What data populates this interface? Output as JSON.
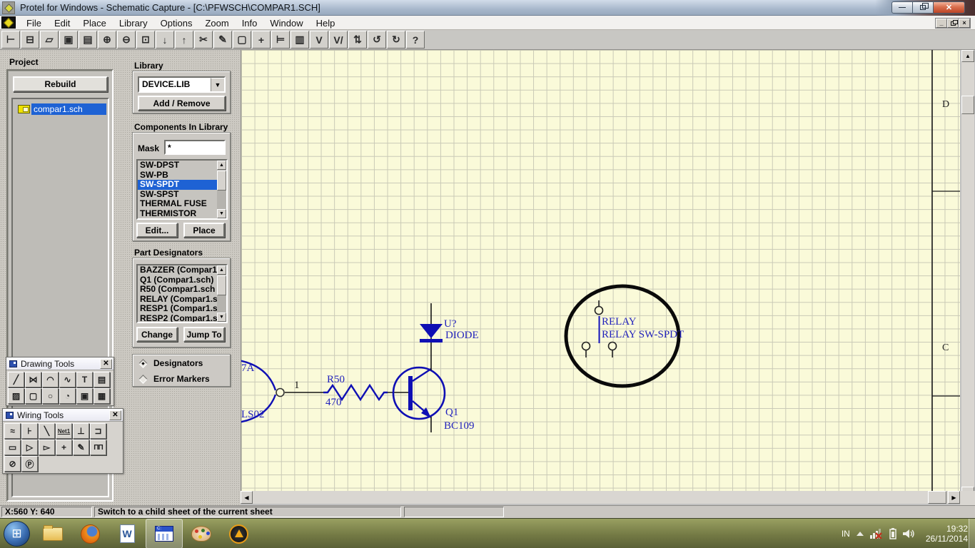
{
  "window": {
    "title": "Protel for Windows - Schematic Capture - [C:\\PFWSCH\\COMPAR1.SCH]"
  },
  "menu": {
    "items": [
      "File",
      "Edit",
      "Place",
      "Library",
      "Options",
      "Zoom",
      "Info",
      "Window",
      "Help"
    ]
  },
  "toolbar": {
    "buttons": [
      {
        "name": "project-hierarchy-button",
        "glyph": "⊢"
      },
      {
        "name": "sheet-symbols-button",
        "glyph": "⊟"
      },
      {
        "name": "open-button",
        "glyph": "▱"
      },
      {
        "name": "save-button",
        "glyph": "▣"
      },
      {
        "name": "print-button",
        "glyph": "▤"
      },
      {
        "name": "zoom-in-button",
        "glyph": "⊕"
      },
      {
        "name": "zoom-out-button",
        "glyph": "⊖"
      },
      {
        "name": "zoom-area-button",
        "glyph": "⊡"
      },
      {
        "name": "descend-sheet-button",
        "glyph": "↓"
      },
      {
        "name": "ascend-sheet-button",
        "glyph": "↑"
      },
      {
        "name": "cut-button",
        "glyph": "✂"
      },
      {
        "name": "draw-button",
        "glyph": "✎"
      },
      {
        "name": "select-area-button",
        "glyph": "▢"
      },
      {
        "name": "move-button",
        "glyph": "+"
      },
      {
        "name": "wire-mode-button",
        "glyph": "⊨"
      },
      {
        "name": "part-browser-button",
        "glyph": "▥"
      },
      {
        "name": "wiring-tools-toggle",
        "glyph": "V"
      },
      {
        "name": "drawing-tools-toggle",
        "glyph": "V/"
      },
      {
        "name": "annotate-button",
        "glyph": "⇅"
      },
      {
        "name": "undo-button",
        "glyph": "↺"
      },
      {
        "name": "redo-button",
        "glyph": "↻"
      },
      {
        "name": "help-button",
        "glyph": "?"
      }
    ]
  },
  "project": {
    "label": "Project",
    "rebuild_label": "Rebuild",
    "files": [
      {
        "name": "project-file-compar1",
        "label": "compar1.sch",
        "selected": true
      }
    ]
  },
  "library": {
    "label": "Library",
    "selected_library": "DEVICE.LIB",
    "add_remove_label": "Add / Remove"
  },
  "components": {
    "label": "Components In Library",
    "mask_label": "Mask",
    "mask_value": "*",
    "items": [
      {
        "label": "SW-DPST"
      },
      {
        "label": "SW-PB"
      },
      {
        "label": "SW-SPDT",
        "selected": true
      },
      {
        "label": "SW-SPST"
      },
      {
        "label": "THERMAL FUSE"
      },
      {
        "label": "THERMISTOR"
      }
    ],
    "edit_label": "Edit...",
    "place_label": "Place"
  },
  "part_designators": {
    "label": "Part Designators",
    "items": [
      {
        "label": "BAZZER (Compar1"
      },
      {
        "label": "Q1 (Compar1.sch)"
      },
      {
        "label": "R50 (Compar1.sch"
      },
      {
        "label": "RELAY (Compar1.s"
      },
      {
        "label": "RESP1 (Compar1.s"
      },
      {
        "label": "RESP2 (Compar1.s"
      }
    ],
    "change_label": "Change",
    "jump_to_label": "Jump To"
  },
  "display_options": {
    "options": [
      {
        "name": "option-designators",
        "label": "Designators",
        "selected": true
      },
      {
        "name": "option-error-markers",
        "label": "Error Markers",
        "selected": false
      }
    ]
  },
  "drawing_tools": {
    "title": "Drawing Tools",
    "tools": [
      {
        "name": "tool-line",
        "glyph": "╱"
      },
      {
        "name": "tool-polygon",
        "glyph": "⋈"
      },
      {
        "name": "tool-arc",
        "glyph": "◠"
      },
      {
        "name": "tool-bezier",
        "glyph": "∿"
      },
      {
        "name": "tool-text",
        "glyph": "T"
      },
      {
        "name": "tool-text-frame",
        "glyph": "▤"
      },
      {
        "name": "tool-rectangle",
        "glyph": "▨"
      },
      {
        "name": "tool-round-rect",
        "glyph": "▢"
      },
      {
        "name": "tool-ellipse",
        "glyph": "○"
      },
      {
        "name": "tool-pie",
        "glyph": "◔"
      },
      {
        "name": "tool-image",
        "glyph": "▣"
      },
      {
        "name": "tool-paste-array",
        "glyph": "▦"
      }
    ]
  },
  "wiring_tools": {
    "title": "Wiring Tools",
    "tools": [
      {
        "name": "tool-wire",
        "glyph": "≈"
      },
      {
        "name": "tool-bus",
        "glyph": "⊦"
      },
      {
        "name": "tool-bus-entry",
        "glyph": "╲"
      },
      {
        "name": "tool-net-label",
        "glyph": "Net1"
      },
      {
        "name": "tool-power-port",
        "glyph": "⊥"
      },
      {
        "name": "tool-part",
        "glyph": "⊐"
      },
      {
        "name": "tool-sheet-symbol",
        "glyph": "▭"
      },
      {
        "name": "tool-sheet-entry",
        "glyph": "▷"
      },
      {
        "name": "tool-port",
        "glyph": "▻"
      },
      {
        "name": "tool-junction",
        "glyph": "+"
      },
      {
        "name": "tool-probe",
        "glyph": "✎"
      },
      {
        "name": "tool-stimulus",
        "glyph": "ΠΠ"
      },
      {
        "name": "tool-no-erc",
        "glyph": "⊘"
      },
      {
        "name": "tool-pcb-directive",
        "glyph": "Ⓟ"
      }
    ]
  },
  "schematic": {
    "gate_ref": "7A",
    "gate_part": "LS02",
    "net_label": "1",
    "resistor_ref": "R50",
    "resistor_value": "470",
    "diode_ref": "U?",
    "diode_value": "DIODE",
    "transistor_ref": "Q1",
    "transistor_value": "BC109",
    "relay_ref": "RELAY",
    "relay_value": "RELAY SW-SPDT",
    "zones": [
      "D",
      "C"
    ]
  },
  "status": {
    "coordinates": "X:560 Y: 640",
    "hint": "Switch to a child sheet of the current sheet"
  },
  "taskbar": {
    "tray": {
      "language": "IN",
      "time": "19:32",
      "date": "26/11/2014"
    }
  }
}
